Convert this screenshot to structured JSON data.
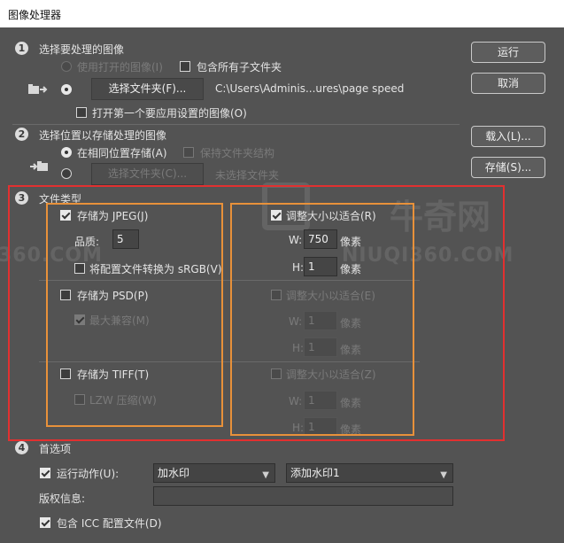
{
  "window_title": "图像处理器",
  "section1": {
    "number": "1",
    "title": "选择要处理的图像",
    "use_open_label": "使用打开的图像(I)",
    "include_sub_label": "包含所有子文件夹",
    "select_folder_btn": "选择文件夹(F)...",
    "folder_path": "C:\\Users\\Adminis...ures\\page speed",
    "open_first_label": "打开第一个要应用设置的图像(O)"
  },
  "section2": {
    "number": "2",
    "title": "选择位置以存储处理的图像",
    "same_location_label": "在相同位置存储(A)",
    "keep_structure_label": "保持文件夹结构",
    "select_folder_btn": "选择文件夹(C)...",
    "no_folder_label": "未选择文件夹"
  },
  "section3": {
    "number": "3",
    "title": "文件类型",
    "jpeg": {
      "save_label": "存储为 JPEG(J)",
      "quality_label": "品质:",
      "quality_value": "5",
      "srgb_label": "将配置文件转换为 sRGB(V)",
      "resize_label": "调整大小以适合(R)",
      "w_label": "W:",
      "w_value": "750",
      "w_unit": "像素",
      "h_label": "H:",
      "h_value": "1",
      "h_unit": "像素"
    },
    "psd": {
      "save_label": "存储为 PSD(P)",
      "max_compat_label": "最大兼容(M)",
      "resize_label": "调整大小以适合(E)",
      "w_label": "W:",
      "w_value": "1",
      "w_unit": "像素",
      "h_label": "H:",
      "h_value": "1",
      "h_unit": "像素"
    },
    "tiff": {
      "save_label": "存储为 TIFF(T)",
      "lzw_label": "LZW 压缩(W)",
      "resize_label": "调整大小以适合(Z)",
      "w_label": "W:",
      "w_value": "1",
      "w_unit": "像素",
      "h_label": "H:",
      "h_value": "1",
      "h_unit": "像素"
    }
  },
  "section4": {
    "number": "4",
    "title": "首选项",
    "run_action_label": "运行动作(U):",
    "action_set": "加水印",
    "action_name": "添加水印1",
    "copyright_label": "版权信息:",
    "copyright_value": "",
    "icc_label": "包含 ICC 配置文件(D)"
  },
  "buttons": {
    "run": "运行",
    "cancel": "取消",
    "load": "载入(L)...",
    "save": "存储(S)..."
  },
  "watermark": {
    "brand_cn": "牛奇网",
    "brand_url": "NIUQI360.COM",
    "brand_url_partial": "360.COM"
  },
  "colors": {
    "background": "#535353",
    "highlight_red": "#e23030",
    "highlight_orange": "#e8913a"
  }
}
